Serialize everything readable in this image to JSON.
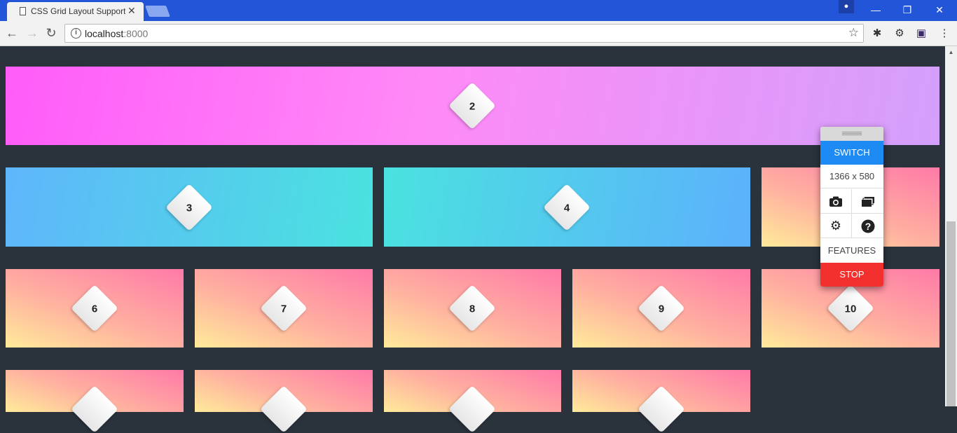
{
  "browser": {
    "tab_title": "CSS Grid Layout Support",
    "tab_close": "✕",
    "url_host": "localhost",
    "url_port": ":8000",
    "window_controls": {
      "minimize": "—",
      "maximize": "❐",
      "close": "✕"
    }
  },
  "grid": {
    "items": [
      "2",
      "3",
      "4",
      "6",
      "7",
      "8",
      "9",
      "10"
    ]
  },
  "panel": {
    "switch_label": "SWITCH",
    "resolution": "1366 x 580",
    "features_label": "FEATURES",
    "stop_label": "STOP"
  },
  "colors": {
    "titlebar": "#2255d8",
    "panel_switch": "#1e8bf5",
    "panel_stop": "#f2302d",
    "page_bg": "#2a323c"
  },
  "icons": {
    "camera": "camera-icon",
    "gallery": "gallery-icon",
    "settings": "gear-icon",
    "help": "help-icon"
  }
}
